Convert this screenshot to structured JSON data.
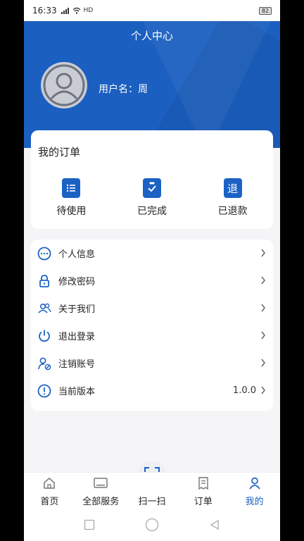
{
  "status_bar": {
    "time": "16:33",
    "network": "HD",
    "battery": "82"
  },
  "header": {
    "title": "个人中心",
    "username": "用户名：周"
  },
  "orders": {
    "title": "我的订单",
    "items": [
      {
        "label": "待使用",
        "icon": "list-document-icon"
      },
      {
        "label": "已完成",
        "icon": "clipboard-check-icon"
      },
      {
        "label": "已退款",
        "icon": "refund-icon",
        "glyph": "退"
      }
    ]
  },
  "menu": {
    "items": [
      {
        "label": "个人信息",
        "icon": "chat-bubble-icon"
      },
      {
        "label": "修改密码",
        "icon": "lock-icon"
      },
      {
        "label": "关于我们",
        "icon": "people-icon"
      },
      {
        "label": "退出登录",
        "icon": "power-icon"
      },
      {
        "label": "注销账号",
        "icon": "user-cancel-icon"
      },
      {
        "label": "当前版本",
        "icon": "info-icon",
        "value": "1.0.0"
      }
    ]
  },
  "tabbar": {
    "items": [
      {
        "label": "首页",
        "icon": "home-icon"
      },
      {
        "label": "全部服务",
        "icon": "services-icon"
      },
      {
        "label": "扫一扫",
        "icon": "scan-icon"
      },
      {
        "label": "订单",
        "icon": "order-icon"
      },
      {
        "label": "我的",
        "icon": "profile-icon",
        "active": true
      }
    ]
  },
  "colors": {
    "primary": "#1b5fc0",
    "icon_blue": "#1b62c4",
    "background": "#f5f5f7"
  }
}
